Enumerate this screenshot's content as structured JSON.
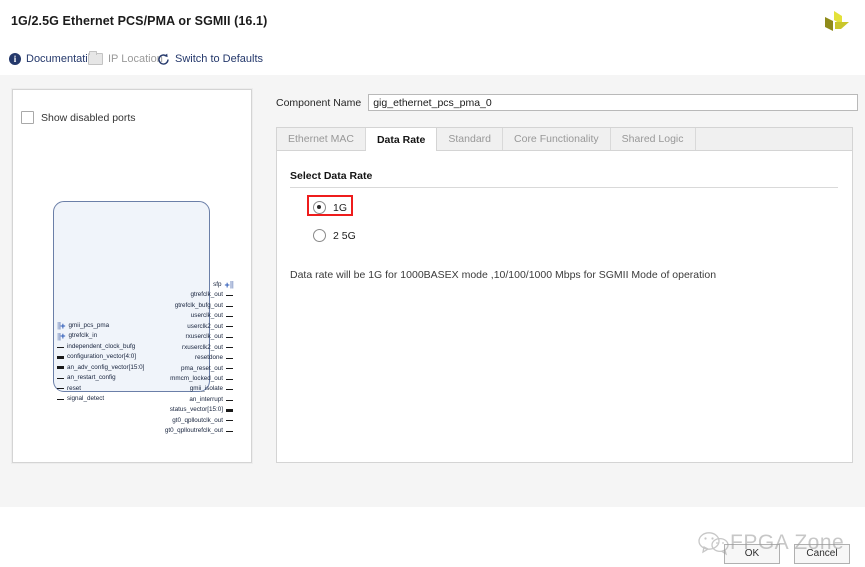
{
  "header": {
    "title": "1G/2.5G Ethernet PCS/PMA or SGMII (16.1)",
    "logo_icon": "xilinx-logo-icon"
  },
  "toolbar": {
    "documentation": {
      "label": "Documentation",
      "icon": "info-icon"
    },
    "ip_location": {
      "label": "IP Location",
      "icon": "folder-icon"
    },
    "switch_defaults": {
      "label": "Switch to Defaults",
      "icon": "refresh-icon"
    }
  },
  "left_panel": {
    "show_disabled_ports": {
      "label": "Show disabled ports",
      "checked": false
    },
    "diagram": {
      "left_ports": [
        {
          "name": "gmii_pcs_pma",
          "type": "group"
        },
        {
          "name": "gtrefclk_in",
          "type": "group"
        },
        {
          "name": "independent_clock_bufg",
          "type": "wire"
        },
        {
          "name": "configuration_vector[4:0]",
          "type": "bus"
        },
        {
          "name": "an_adv_config_vector[15:0]",
          "type": "bus"
        },
        {
          "name": "an_restart_config",
          "type": "wire"
        },
        {
          "name": "reset",
          "type": "wire"
        },
        {
          "name": "signal_detect",
          "type": "wire"
        }
      ],
      "right_ports": [
        {
          "name": "sfp",
          "type": "group"
        },
        {
          "name": "gtrefclk_out",
          "type": "wire"
        },
        {
          "name": "gtrefclk_bufg_out",
          "type": "wire"
        },
        {
          "name": "userclk_out",
          "type": "wire"
        },
        {
          "name": "userclk2_out",
          "type": "wire"
        },
        {
          "name": "rxuserclk_out",
          "type": "wire"
        },
        {
          "name": "rxuserclk2_out",
          "type": "wire"
        },
        {
          "name": "resetdone",
          "type": "wire"
        },
        {
          "name": "pma_reset_out",
          "type": "wire"
        },
        {
          "name": "mmcm_locked_out",
          "type": "wire"
        },
        {
          "name": "gmii_isolate",
          "type": "wire"
        },
        {
          "name": "an_interrupt",
          "type": "wire"
        },
        {
          "name": "status_vector[15:0]",
          "type": "bus"
        },
        {
          "name": "gt0_qplloutclk_out",
          "type": "wire"
        },
        {
          "name": "gt0_qplloutrefclk_out",
          "type": "wire"
        }
      ]
    }
  },
  "component_name": {
    "label": "Component Name",
    "value": "gig_ethernet_pcs_pma_0",
    "placeholder": "Component Name"
  },
  "tabs": [
    {
      "label": "Ethernet MAC",
      "active": false
    },
    {
      "label": "Data Rate",
      "active": true
    },
    {
      "label": "Standard",
      "active": false
    },
    {
      "label": "Core Functionality",
      "active": false
    },
    {
      "label": "Shared Logic",
      "active": false
    }
  ],
  "data_rate_panel": {
    "section_title": "Select Data Rate",
    "options": [
      {
        "label": "1G",
        "selected": true,
        "highlighted": true
      },
      {
        "label": "2 5G",
        "selected": false,
        "highlighted": false
      }
    ],
    "note": "Data rate will be 1G for 1000BASEX mode ,10/100/1000 Mbps for SGMII Mode of operation"
  },
  "footer": {
    "ok_label": "OK",
    "cancel_label": "Cancel"
  },
  "watermark": {
    "text": "FPGA Zone",
    "icon": "wechat-icon"
  },
  "colors": {
    "accent_link": "#24386b",
    "highlight_red": "#ee1c1c",
    "panel_bg": "#f5f5f5",
    "diagram_fill": "#f0f4fa",
    "diagram_border": "#6b7fa8"
  }
}
